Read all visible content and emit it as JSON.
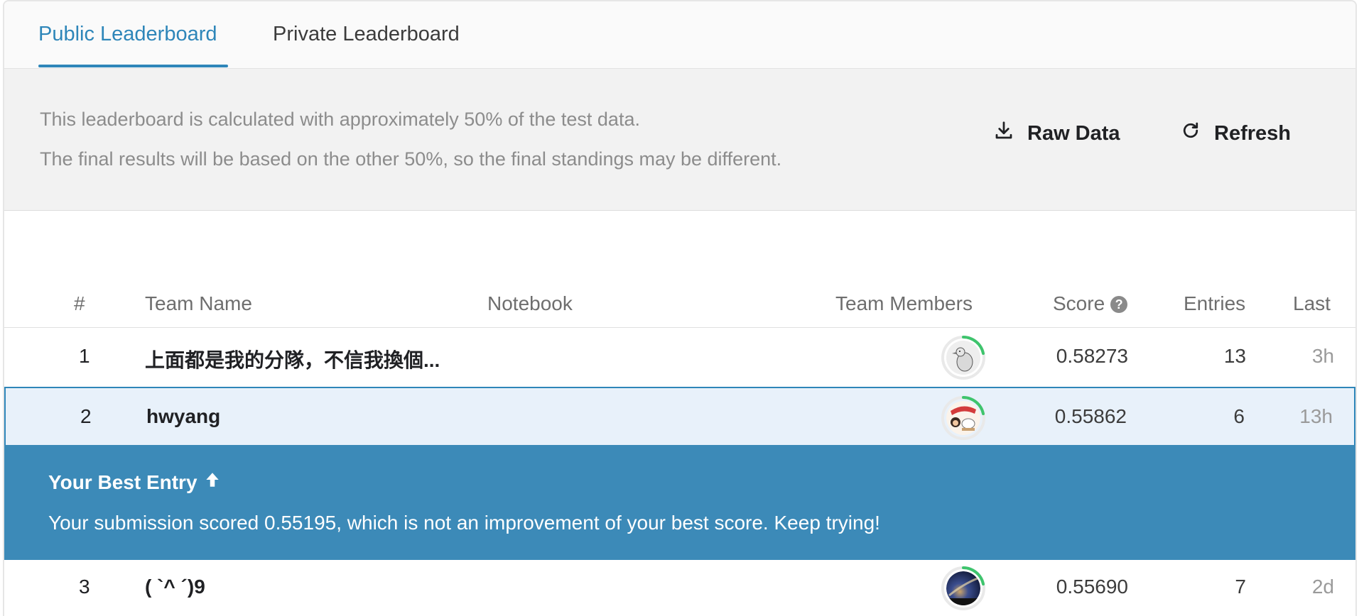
{
  "tabs": [
    {
      "label": "Public Leaderboard",
      "active": true
    },
    {
      "label": "Private Leaderboard",
      "active": false
    }
  ],
  "notice": {
    "line1": "This leaderboard is calculated with approximately 50% of the test data.",
    "line2": "The final results will be based on the other 50%, so the final standings may be different."
  },
  "actions": {
    "raw_data_label": "Raw Data",
    "refresh_label": "Refresh",
    "raw_data_icon": "download-icon",
    "refresh_icon": "refresh-icon"
  },
  "table": {
    "headers": {
      "rank": "#",
      "team_name": "Team Name",
      "notebook": "Notebook",
      "team_members": "Team Members",
      "score": "Score",
      "entries": "Entries",
      "last": "Last"
    },
    "rows": [
      {
        "rank": "1",
        "team_name": "上面都是我的分隊，不信我換個...",
        "score": "0.58273",
        "entries": "13",
        "last": "3h",
        "avatar_icon": "goose-avatar",
        "highlight": false
      },
      {
        "rank": "2",
        "team_name": "hwyang",
        "score": "0.55862",
        "entries": "6",
        "last": "13h",
        "avatar_icon": "cartoon-avatar",
        "highlight": true
      },
      {
        "rank": "3",
        "team_name": "( `^ ´)9",
        "score": "0.55690",
        "entries": "7",
        "last": "2d",
        "avatar_icon": "galaxy-avatar",
        "highlight": false
      }
    ]
  },
  "banner": {
    "title": "Your Best Entry",
    "title_icon": "arrow-up-icon",
    "message": "Your submission scored 0.55195, which is not an improvement of your best score. Keep trying!"
  },
  "colors": {
    "accent": "#2e86b9",
    "banner_bg": "#3c8ab8",
    "highlight_row_bg": "#e8f1fa",
    "progress_ring": "#3ec46d"
  }
}
